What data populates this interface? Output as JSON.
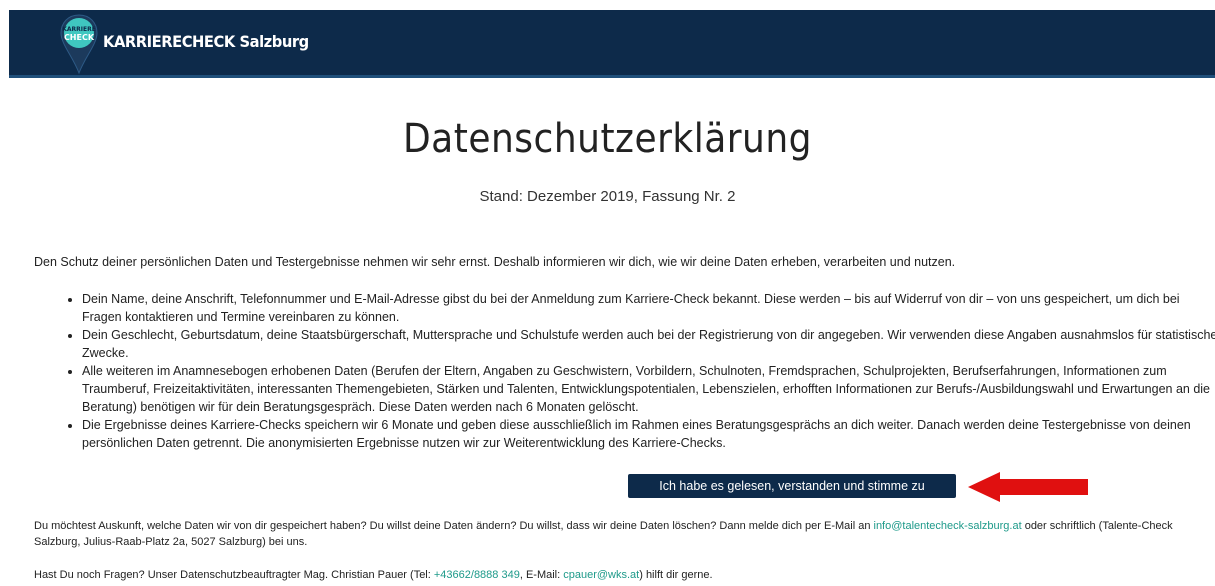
{
  "header": {
    "brand": "KARRIERECHECK Salzburg",
    "logo_text_top": "KARRIERE",
    "logo_text_bottom": "CHECK",
    "bg_color": "#0d2a4a"
  },
  "page": {
    "title": "Datenschutzerklärung",
    "subtitle": "Stand: Dezember 2019, Fassung Nr. 2",
    "intro": "Den Schutz deiner persönlichen Daten und Testergebnisse nehmen wir sehr ernst. Deshalb informieren wir dich, wie wir deine Daten erheben, verarbeiten und nutzen.",
    "bullets": [
      "Dein Name, deine Anschrift, Telefonnummer und E-Mail-Adresse gibst du bei der Anmeldung zum Karriere-Check bekannt. Diese werden – bis auf Widerruf von dir – von uns gespeichert, um dich bei Fragen kontaktieren und Termine vereinbaren zu können.",
      "Dein Geschlecht, Geburtsdatum, deine Staatsbürgerschaft, Muttersprache und Schulstufe werden auch bei der Registrierung von dir angegeben. Wir verwenden diese Angaben ausnahmslos für statistische Zwecke.",
      "Alle weiteren im Anamnesebogen erhobenen Daten (Berufen der Eltern, Angaben zu Geschwistern, Vorbildern, Schulnoten, Fremdsprachen, Schulprojekten, Berufserfahrungen, Informationen zum Traumberuf, Freizeitaktivitäten, interessanten Themengebieten, Stärken und Talenten, Entwicklungspotentialen, Lebenszielen, erhofften Informationen zur Berufs-/Ausbildungswahl und Erwartungen an die Beratung) benötigen wir für dein Beratungsgespräch. Diese Daten werden nach 6 Monaten gelöscht.",
      "Die Ergebnisse deines Karriere-Checks speichern wir 6 Monate und geben diese ausschließlich im Rahmen eines Beratungsgesprächs an dich weiter. Danach werden deine Testergebnisse von deinen persönlichen Daten getrennt. Die anonymisierten Ergebnisse nutzen wir zur Weiterentwicklung des Karriere-Checks."
    ],
    "agree_button": "Ich habe es gelesen, verstanden und stimme zu",
    "contact": {
      "before": "Du möchtest Auskunft, welche Daten wir von dir gespeichert haben? Du willst deine Daten ändern? Du willst, dass wir deine Daten löschen? Dann melde dich per E-Mail an ",
      "email": "info@talentecheck-salzburg.at",
      "after": " oder schriftlich (Talente-Check Salzburg, Julius-Raab-Platz 2a, 5027 Salzburg) bei uns."
    },
    "questions": {
      "before": "Hast Du noch Fragen? Unser Datenschutzbeauftragter Mag. Christian Pauer (Tel: ",
      "phone": "+43662/8888 349",
      "middle": ", E-Mail: ",
      "email": "cpauer@wks.at",
      "after": ") hilft dir gerne."
    }
  },
  "colors": {
    "accent_link": "#1e9a8a",
    "arrow": "#e01010",
    "logo_teal": "#3fc7c0"
  }
}
